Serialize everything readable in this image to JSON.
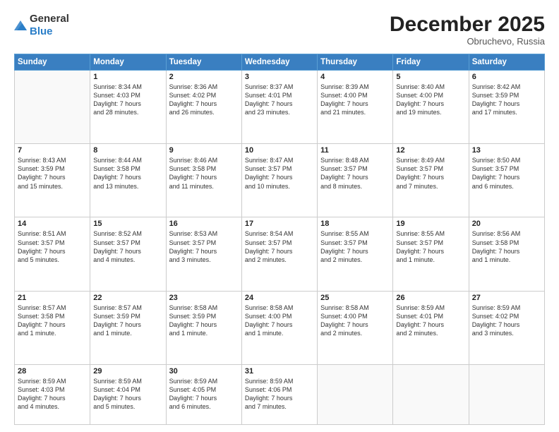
{
  "header": {
    "logo_general": "General",
    "logo_blue": "Blue",
    "month_title": "December 2025",
    "location": "Obruchevo, Russia"
  },
  "days_of_week": [
    "Sunday",
    "Monday",
    "Tuesday",
    "Wednesday",
    "Thursday",
    "Friday",
    "Saturday"
  ],
  "weeks": [
    [
      {
        "day": "",
        "lines": []
      },
      {
        "day": "1",
        "lines": [
          "Sunrise: 8:34 AM",
          "Sunset: 4:03 PM",
          "Daylight: 7 hours",
          "and 28 minutes."
        ]
      },
      {
        "day": "2",
        "lines": [
          "Sunrise: 8:36 AM",
          "Sunset: 4:02 PM",
          "Daylight: 7 hours",
          "and 26 minutes."
        ]
      },
      {
        "day": "3",
        "lines": [
          "Sunrise: 8:37 AM",
          "Sunset: 4:01 PM",
          "Daylight: 7 hours",
          "and 23 minutes."
        ]
      },
      {
        "day": "4",
        "lines": [
          "Sunrise: 8:39 AM",
          "Sunset: 4:00 PM",
          "Daylight: 7 hours",
          "and 21 minutes."
        ]
      },
      {
        "day": "5",
        "lines": [
          "Sunrise: 8:40 AM",
          "Sunset: 4:00 PM",
          "Daylight: 7 hours",
          "and 19 minutes."
        ]
      },
      {
        "day": "6",
        "lines": [
          "Sunrise: 8:42 AM",
          "Sunset: 3:59 PM",
          "Daylight: 7 hours",
          "and 17 minutes."
        ]
      }
    ],
    [
      {
        "day": "7",
        "lines": [
          "Sunrise: 8:43 AM",
          "Sunset: 3:59 PM",
          "Daylight: 7 hours",
          "and 15 minutes."
        ]
      },
      {
        "day": "8",
        "lines": [
          "Sunrise: 8:44 AM",
          "Sunset: 3:58 PM",
          "Daylight: 7 hours",
          "and 13 minutes."
        ]
      },
      {
        "day": "9",
        "lines": [
          "Sunrise: 8:46 AM",
          "Sunset: 3:58 PM",
          "Daylight: 7 hours",
          "and 11 minutes."
        ]
      },
      {
        "day": "10",
        "lines": [
          "Sunrise: 8:47 AM",
          "Sunset: 3:57 PM",
          "Daylight: 7 hours",
          "and 10 minutes."
        ]
      },
      {
        "day": "11",
        "lines": [
          "Sunrise: 8:48 AM",
          "Sunset: 3:57 PM",
          "Daylight: 7 hours",
          "and 8 minutes."
        ]
      },
      {
        "day": "12",
        "lines": [
          "Sunrise: 8:49 AM",
          "Sunset: 3:57 PM",
          "Daylight: 7 hours",
          "and 7 minutes."
        ]
      },
      {
        "day": "13",
        "lines": [
          "Sunrise: 8:50 AM",
          "Sunset: 3:57 PM",
          "Daylight: 7 hours",
          "and 6 minutes."
        ]
      }
    ],
    [
      {
        "day": "14",
        "lines": [
          "Sunrise: 8:51 AM",
          "Sunset: 3:57 PM",
          "Daylight: 7 hours",
          "and 5 minutes."
        ]
      },
      {
        "day": "15",
        "lines": [
          "Sunrise: 8:52 AM",
          "Sunset: 3:57 PM",
          "Daylight: 7 hours",
          "and 4 minutes."
        ]
      },
      {
        "day": "16",
        "lines": [
          "Sunrise: 8:53 AM",
          "Sunset: 3:57 PM",
          "Daylight: 7 hours",
          "and 3 minutes."
        ]
      },
      {
        "day": "17",
        "lines": [
          "Sunrise: 8:54 AM",
          "Sunset: 3:57 PM",
          "Daylight: 7 hours",
          "and 2 minutes."
        ]
      },
      {
        "day": "18",
        "lines": [
          "Sunrise: 8:55 AM",
          "Sunset: 3:57 PM",
          "Daylight: 7 hours",
          "and 2 minutes."
        ]
      },
      {
        "day": "19",
        "lines": [
          "Sunrise: 8:55 AM",
          "Sunset: 3:57 PM",
          "Daylight: 7 hours",
          "and 1 minute."
        ]
      },
      {
        "day": "20",
        "lines": [
          "Sunrise: 8:56 AM",
          "Sunset: 3:58 PM",
          "Daylight: 7 hours",
          "and 1 minute."
        ]
      }
    ],
    [
      {
        "day": "21",
        "lines": [
          "Sunrise: 8:57 AM",
          "Sunset: 3:58 PM",
          "Daylight: 7 hours",
          "and 1 minute."
        ]
      },
      {
        "day": "22",
        "lines": [
          "Sunrise: 8:57 AM",
          "Sunset: 3:59 PM",
          "Daylight: 7 hours",
          "and 1 minute."
        ]
      },
      {
        "day": "23",
        "lines": [
          "Sunrise: 8:58 AM",
          "Sunset: 3:59 PM",
          "Daylight: 7 hours",
          "and 1 minute."
        ]
      },
      {
        "day": "24",
        "lines": [
          "Sunrise: 8:58 AM",
          "Sunset: 4:00 PM",
          "Daylight: 7 hours",
          "and 1 minute."
        ]
      },
      {
        "day": "25",
        "lines": [
          "Sunrise: 8:58 AM",
          "Sunset: 4:00 PM",
          "Daylight: 7 hours",
          "and 2 minutes."
        ]
      },
      {
        "day": "26",
        "lines": [
          "Sunrise: 8:59 AM",
          "Sunset: 4:01 PM",
          "Daylight: 7 hours",
          "and 2 minutes."
        ]
      },
      {
        "day": "27",
        "lines": [
          "Sunrise: 8:59 AM",
          "Sunset: 4:02 PM",
          "Daylight: 7 hours",
          "and 3 minutes."
        ]
      }
    ],
    [
      {
        "day": "28",
        "lines": [
          "Sunrise: 8:59 AM",
          "Sunset: 4:03 PM",
          "Daylight: 7 hours",
          "and 4 minutes."
        ]
      },
      {
        "day": "29",
        "lines": [
          "Sunrise: 8:59 AM",
          "Sunset: 4:04 PM",
          "Daylight: 7 hours",
          "and 5 minutes."
        ]
      },
      {
        "day": "30",
        "lines": [
          "Sunrise: 8:59 AM",
          "Sunset: 4:05 PM",
          "Daylight: 7 hours",
          "and 6 minutes."
        ]
      },
      {
        "day": "31",
        "lines": [
          "Sunrise: 8:59 AM",
          "Sunset: 4:06 PM",
          "Daylight: 7 hours",
          "and 7 minutes."
        ]
      },
      {
        "day": "",
        "lines": []
      },
      {
        "day": "",
        "lines": []
      },
      {
        "day": "",
        "lines": []
      }
    ]
  ]
}
